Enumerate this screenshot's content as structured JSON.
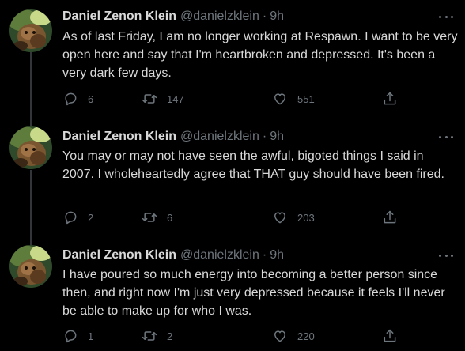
{
  "tweets": [
    {
      "author_name": "Daniel Zenon Klein",
      "handle": "@danielzklein",
      "separator": "·",
      "time": "9h",
      "text": "As of last Friday, I am no longer working at Respawn. I want to be very open here and say that I'm heartbroken and depressed. It's been a very dark few days.",
      "replies": "6",
      "retweets": "147",
      "likes": "551"
    },
    {
      "author_name": "Daniel Zenon Klein",
      "handle": "@danielzklein",
      "separator": "·",
      "time": "9h",
      "text": "You may or may not have seen the awful, bigoted things I said in 2007. I wholeheartedly agree that THAT guy should have been fired.",
      "replies": "2",
      "retweets": "6",
      "likes": "203"
    },
    {
      "author_name": "Daniel Zenon Klein",
      "handle": "@danielzklein",
      "separator": "·",
      "time": "9h",
      "text": "I have poured so much energy into becoming a better person since then, and right now I'm just very depressed because it feels I'll never be able to make up for who I was.",
      "replies": "1",
      "retweets": "2",
      "likes": "220"
    }
  ],
  "icons": {
    "reply": "reply-icon",
    "retweet": "retweet-icon",
    "like": "heart-icon",
    "share": "share-icon",
    "more": "more-icon"
  },
  "colors": {
    "background": "#000000",
    "text": "#d9d9d9",
    "muted": "#6e767d",
    "thread_line": "#333639"
  }
}
